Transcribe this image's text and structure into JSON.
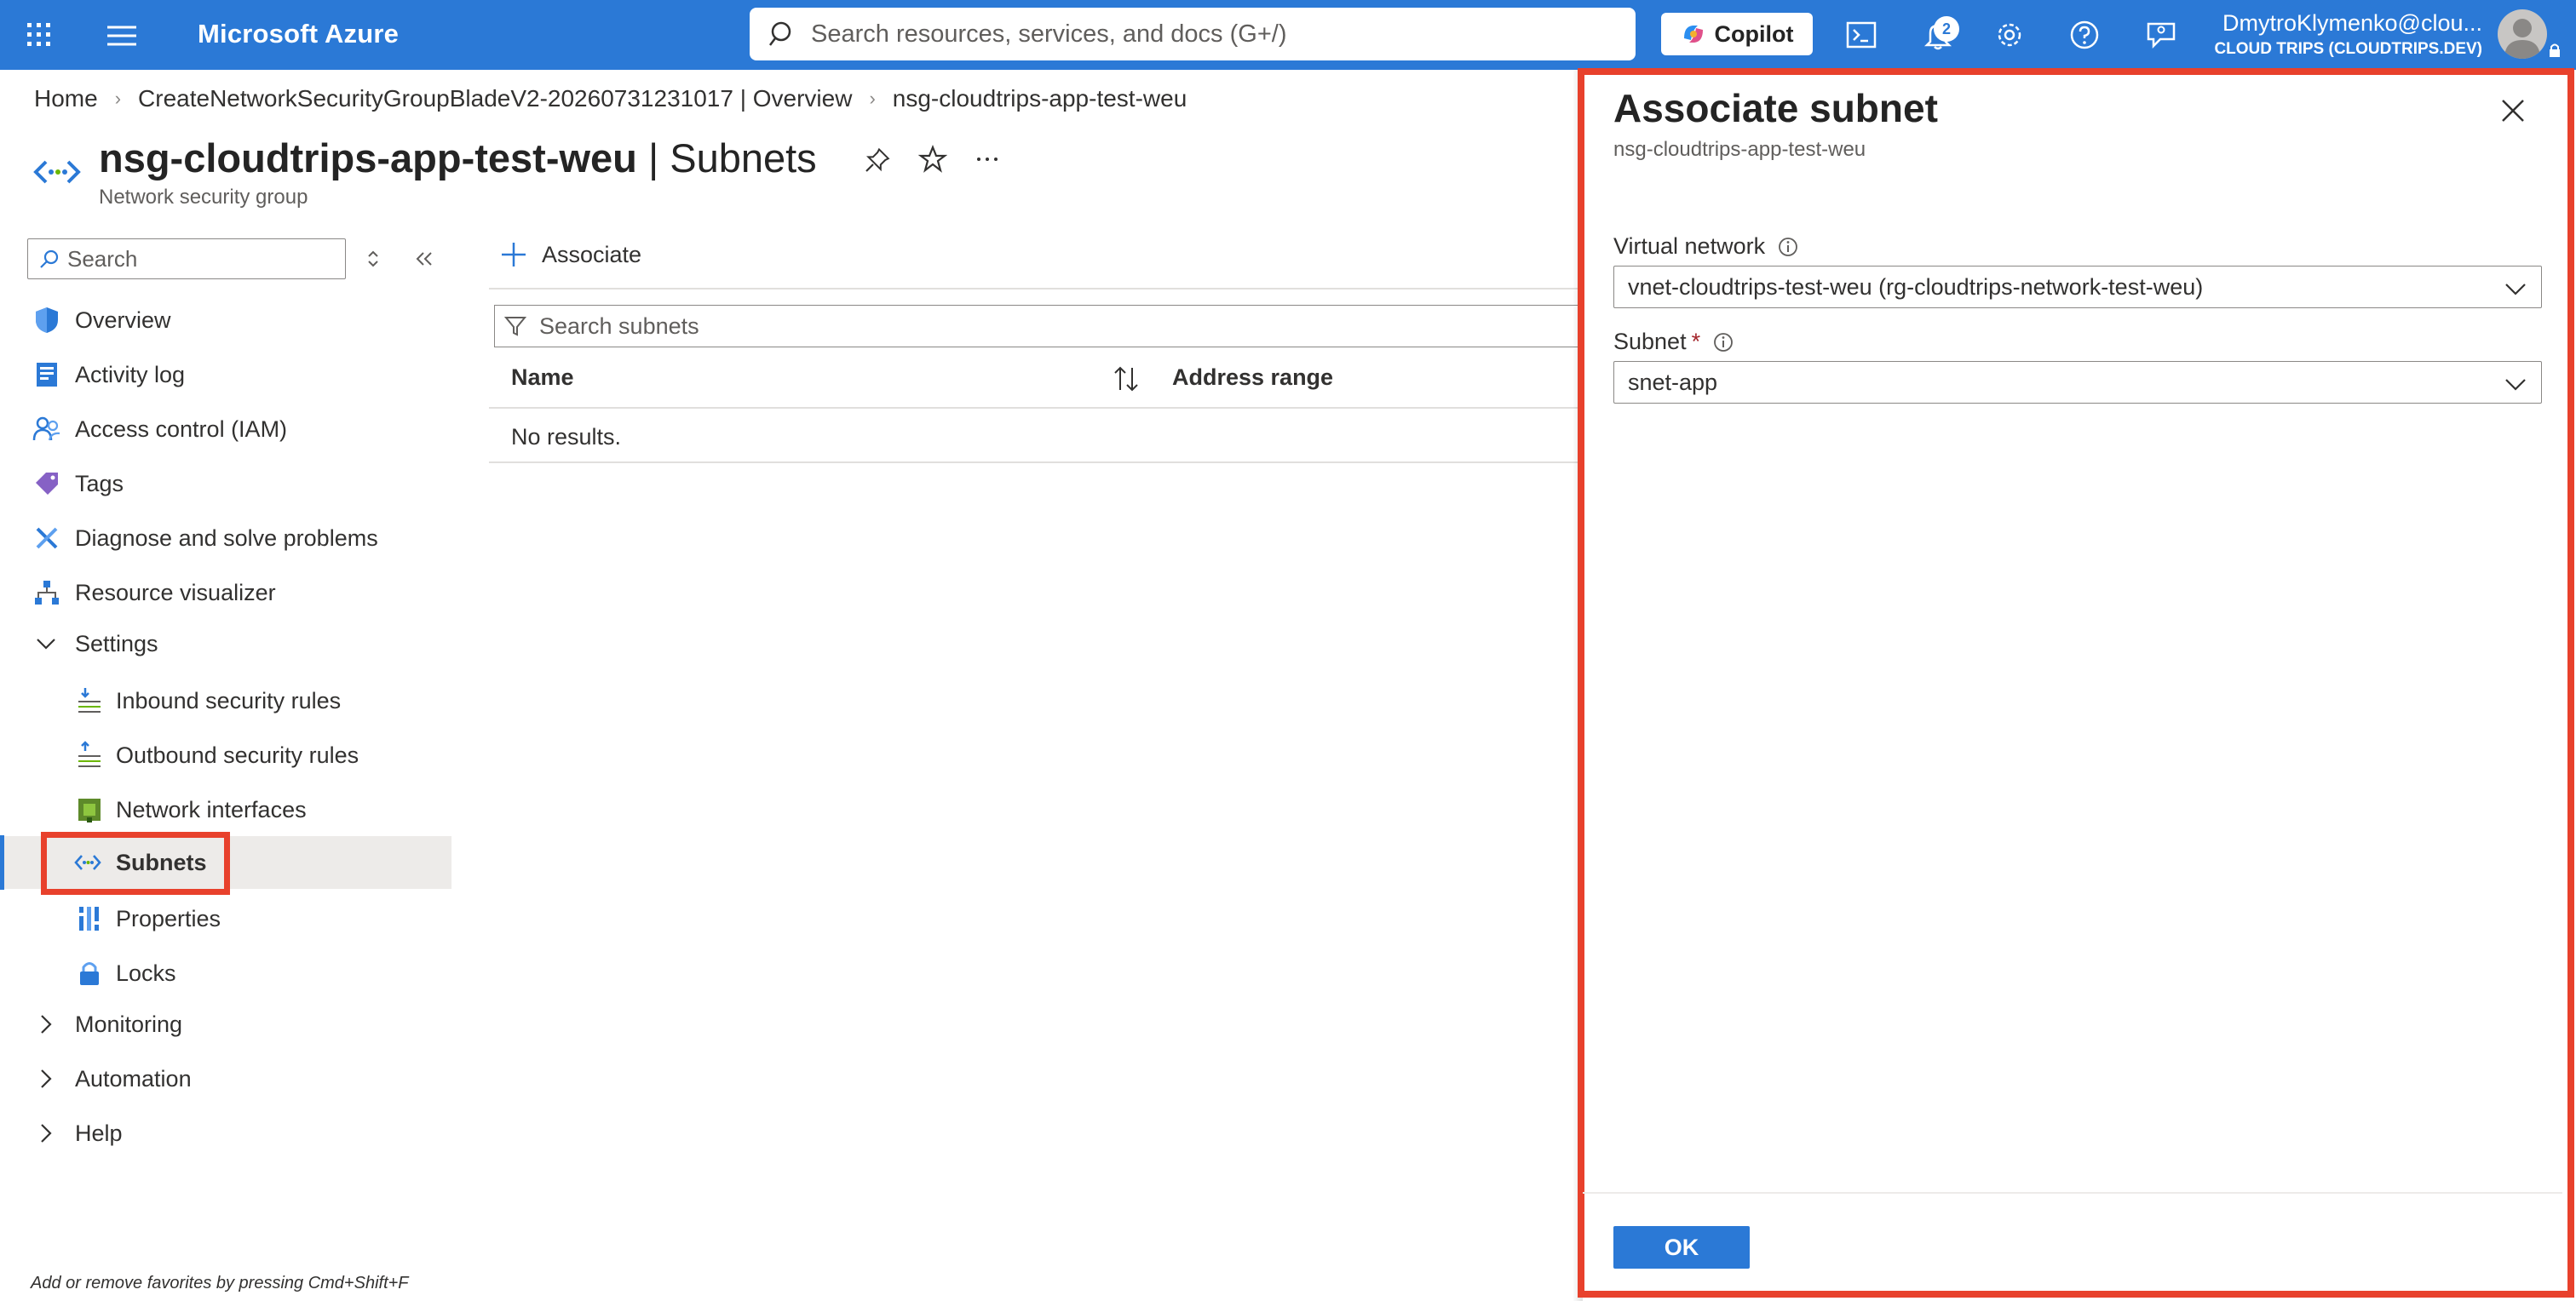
{
  "topbar": {
    "brand": "Microsoft Azure",
    "search_placeholder": "Search resources, services, and docs (G+/)",
    "copilot_label": "Copilot",
    "notification_count": "2",
    "account_name": "DmytroKlymenko@clou...",
    "account_tenant": "CLOUD TRIPS (CLOUDTRIPS.DEV)",
    "accent_color": "#2b79d6"
  },
  "breadcrumb": {
    "items": [
      "Home",
      "CreateNetworkSecurityGroupBladeV2-20260731231017 | Overview",
      "nsg-cloudtrips-app-test-weu"
    ]
  },
  "page": {
    "resource_name": "nsg-cloudtrips-app-test-weu",
    "section_suffix": " | Subnets",
    "subtitle": "Network security group"
  },
  "nav": {
    "search_placeholder": "Search",
    "items": [
      {
        "label": "Overview",
        "icon": "shield-icon"
      },
      {
        "label": "Activity log",
        "icon": "activity-log-icon"
      },
      {
        "label": "Access control (IAM)",
        "icon": "people-icon"
      },
      {
        "label": "Tags",
        "icon": "tag-icon"
      },
      {
        "label": "Diagnose and solve problems",
        "icon": "wrench-icon"
      },
      {
        "label": "Resource visualizer",
        "icon": "hierarchy-icon"
      },
      {
        "label": "Settings",
        "icon": "chevron-down-icon"
      },
      {
        "label": "Inbound security rules",
        "icon": "inbound-rules-icon"
      },
      {
        "label": "Outbound security rules",
        "icon": "outbound-rules-icon"
      },
      {
        "label": "Network interfaces",
        "icon": "nic-icon"
      },
      {
        "label": "Subnets",
        "icon": "subnet-icon"
      },
      {
        "label": "Properties",
        "icon": "properties-icon"
      },
      {
        "label": "Locks",
        "icon": "lock-icon"
      },
      {
        "label": "Monitoring",
        "icon": "chevron-right-icon"
      },
      {
        "label": "Automation",
        "icon": "chevron-right-icon"
      },
      {
        "label": "Help",
        "icon": "chevron-right-icon"
      }
    ],
    "selected": "Subnets",
    "footer_hint": "Add or remove favorites by pressing Cmd+Shift+F"
  },
  "content": {
    "associate_label": "Associate",
    "filter_placeholder": "Search subnets",
    "columns": [
      "Name",
      "Address range"
    ],
    "empty_text": "No results."
  },
  "panel": {
    "title": "Associate subnet",
    "subtitle": "nsg-cloudtrips-app-test-weu",
    "vnet_label": "Virtual network",
    "vnet_value": "vnet-cloudtrips-test-weu (rg-cloudtrips-network-test-weu)",
    "subnet_label": "Subnet",
    "subnet_required": "*",
    "subnet_value": "snet-app",
    "ok_label": "OK",
    "highlight_color": "#e8412c"
  }
}
